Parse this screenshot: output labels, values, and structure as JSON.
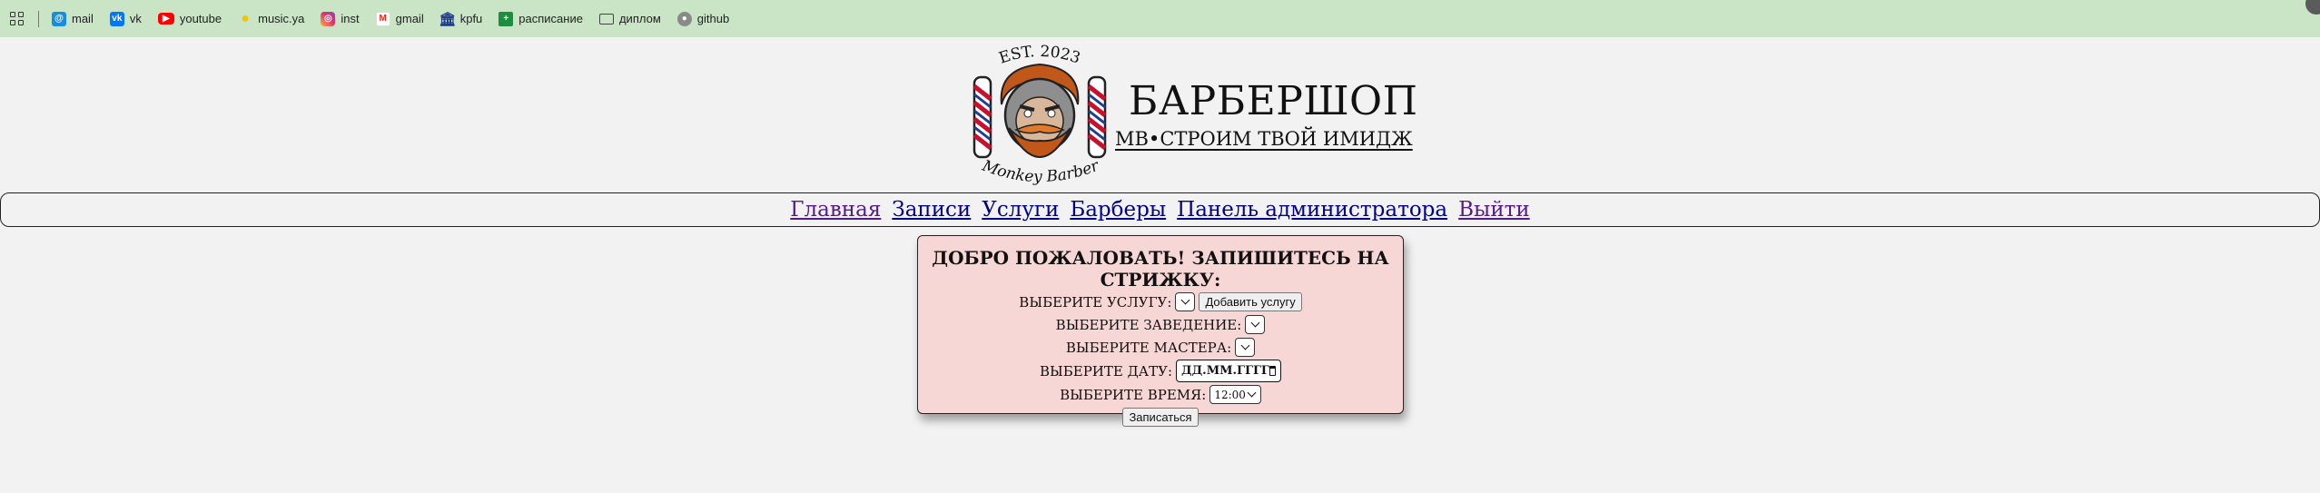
{
  "bookmarks": [
    {
      "label": "mail",
      "icon": "mail-icon"
    },
    {
      "label": "vk",
      "icon": "vk-icon"
    },
    {
      "label": "youtube",
      "icon": "youtube-icon"
    },
    {
      "label": "music.ya",
      "icon": "music-icon"
    },
    {
      "label": "inst",
      "icon": "instagram-icon"
    },
    {
      "label": "gmail",
      "icon": "gmail-icon"
    },
    {
      "label": "kpfu",
      "icon": "university-icon"
    },
    {
      "label": "расписание",
      "icon": "sheets-icon"
    },
    {
      "label": "диплом",
      "icon": "folder-icon"
    },
    {
      "label": "github",
      "icon": "github-icon"
    }
  ],
  "header": {
    "logo_top_text": "EST. 2023",
    "logo_bottom_text": "Monkey Barber",
    "title": "БАРБЕРШОП",
    "subtitle": "MB•СТРОИМ ТВОЙ ИМИДЖ"
  },
  "nav": {
    "home": "Главная",
    "records": "Записи",
    "services": "Услуги",
    "barbers": "Барберы",
    "admin": "Панель администратора",
    "logout": "Выйти"
  },
  "form": {
    "heading": "ДОБРО ПОЖАЛОВАТЬ! ЗАПИШИТЕСЬ НА СТРИЖКУ:",
    "service_label": "ВЫБЕРИТЕ УСЛУГУ:",
    "add_service_button": "Добавить услугу",
    "place_label": "ВЫБЕРИТЕ ЗАВЕДЕНИЕ:",
    "master_label": "ВЫБЕРИТЕ МАСТЕРА:",
    "date_label": "ВЫБЕРИТЕ ДАТУ:",
    "date_placeholder": "ДД.ММ.ГГГГ",
    "time_label": "ВЫБЕРИТЕ ВРЕМЯ:",
    "time_value": "12:00",
    "submit_button": "Записаться"
  },
  "colors": {
    "bookmarks_bg": "#c9e5c5",
    "page_bg": "#f2f2f2",
    "card_bg": "#f7d6d6",
    "link": "#00008b",
    "visited_link": "#551a8b"
  }
}
